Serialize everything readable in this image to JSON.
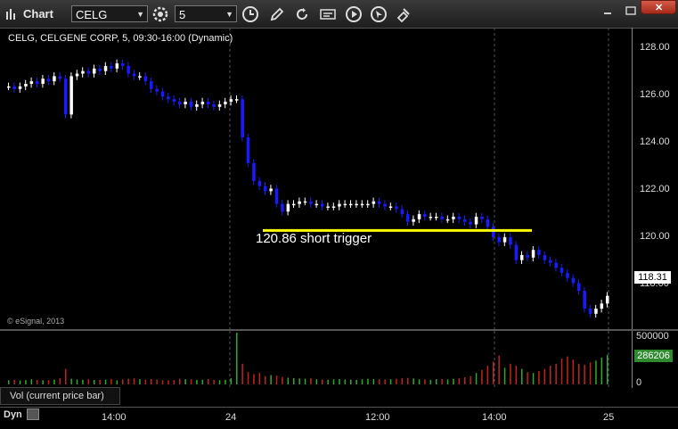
{
  "toolbar": {
    "title": "Chart",
    "symbol": "CELG",
    "interval": "5",
    "icons": [
      "chart-logo-icon",
      "settings-gear-icon",
      "clock-icon",
      "pencil-icon",
      "refresh-icon",
      "quote-icon",
      "play-icon",
      "cursor-icon",
      "link-icon",
      "close-icon"
    ]
  },
  "chart": {
    "title": "CELG, CELGENE CORP, 5, 09:30-16:00 (Dynamic)",
    "copyright": "© eSignal, 2013",
    "annotation": "120.86 short trigger",
    "last_price": "118.31",
    "y_ticks": [
      "128.00",
      "126.00",
      "124.00",
      "122.00",
      "120.00",
      "118.00"
    ],
    "x_ticks": [
      "14:00",
      "24",
      "12:00",
      "14:00",
      "25"
    ]
  },
  "volume": {
    "legend": "Vol (current price bar)",
    "max_label": "500000",
    "zero_label": "0",
    "last_volume": "286206"
  },
  "status": {
    "mode": "Dyn"
  },
  "colors": {
    "up": "#ffffff",
    "down": "#1a1aff",
    "trigger_line": "#ffff00",
    "vol_up": "#2eaa2e",
    "vol_down": "#c22222"
  },
  "chart_data": {
    "type": "candlestick",
    "ylim": [
      117,
      128.8
    ],
    "trigger_level": 120.86,
    "closes": [
      126.5,
      126.4,
      126.5,
      126.6,
      126.7,
      126.6,
      126.8,
      126.7,
      126.9,
      126.8,
      125.4,
      126.9,
      127.0,
      127.1,
      127.0,
      127.2,
      127.1,
      127.3,
      127.2,
      127.4,
      127.3,
      127.0,
      126.9,
      126.9,
      126.7,
      126.4,
      126.3,
      126.1,
      126.0,
      125.9,
      125.8,
      125.9,
      125.7,
      125.8,
      125.9,
      125.8,
      125.7,
      125.8,
      125.9,
      126.0,
      126.0,
      124.5,
      123.5,
      122.8,
      122.6,
      122.4,
      122.5,
      121.9,
      121.6,
      121.9,
      121.9,
      122.0,
      122.0,
      121.9,
      121.9,
      121.8,
      121.8,
      121.8,
      121.9,
      121.9,
      121.9,
      121.9,
      121.9,
      121.9,
      122.0,
      121.9,
      121.8,
      121.8,
      121.7,
      121.5,
      121.2,
      121.3,
      121.5,
      121.4,
      121.4,
      121.4,
      121.3,
      121.3,
      121.4,
      121.3,
      121.2,
      121.1,
      121.4,
      121.3,
      121.0,
      120.6,
      120.4,
      120.6,
      120.3,
      119.7,
      119.9,
      119.8,
      120.1,
      119.9,
      119.7,
      119.6,
      119.4,
      119.2,
      119.0,
      118.8,
      118.5,
      117.8,
      117.6,
      117.8,
      118.0,
      118.3
    ],
    "volumes": [
      40,
      45,
      38,
      42,
      50,
      44,
      39,
      41,
      47,
      60,
      150,
      55,
      48,
      45,
      50,
      43,
      44,
      46,
      52,
      40,
      48,
      55,
      60,
      50,
      45,
      52,
      47,
      40,
      38,
      42,
      55,
      50,
      48,
      44,
      46,
      52,
      43,
      41,
      45,
      60,
      500,
      200,
      120,
      100,
      110,
      80,
      90,
      85,
      70,
      65,
      60,
      58,
      55,
      60,
      50,
      48,
      45,
      50,
      52,
      48,
      46,
      44,
      50,
      55,
      52,
      48,
      46,
      50,
      55,
      60,
      62,
      58,
      50,
      48,
      45,
      50,
      52,
      48,
      55,
      60,
      70,
      80,
      110,
      140,
      180,
      220,
      280,
      160,
      200,
      180,
      150,
      120,
      110,
      130,
      150,
      180,
      200,
      250,
      270,
      240,
      200,
      190,
      210,
      230,
      260,
      286
    ]
  }
}
